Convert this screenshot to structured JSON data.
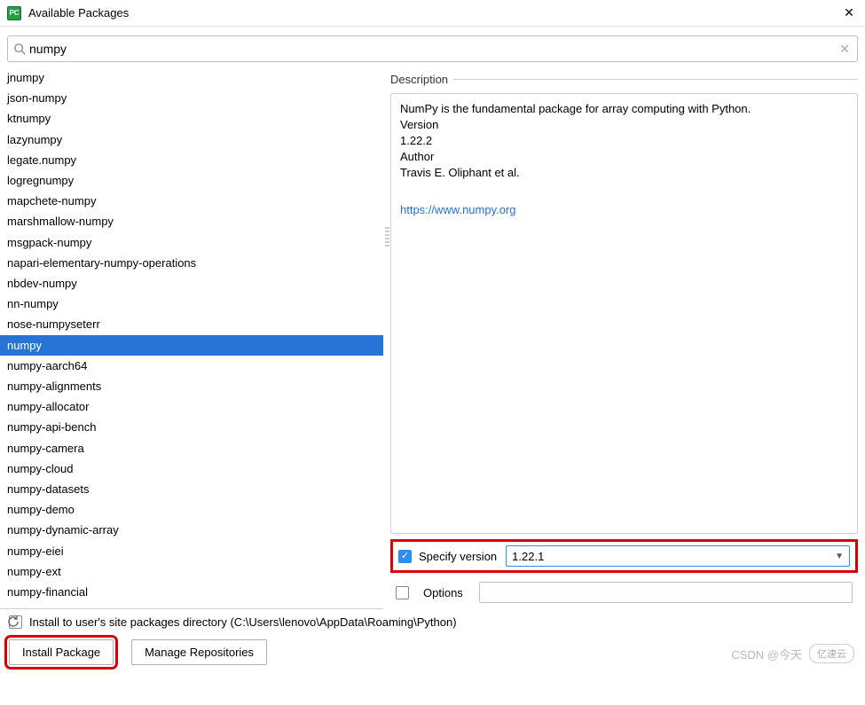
{
  "window": {
    "title": "Available Packages"
  },
  "search": {
    "value": "numpy"
  },
  "packages": {
    "selected_index": 13,
    "items": [
      "jnumpy",
      "json-numpy",
      "ktnumpy",
      "lazynumpy",
      "legate.numpy",
      "logregnumpy",
      "mapchete-numpy",
      "marshmallow-numpy",
      "msgpack-numpy",
      "napari-elementary-numpy-operations",
      "nbdev-numpy",
      "nn-numpy",
      "nose-numpyseterr",
      "numpy",
      "numpy-aarch64",
      "numpy-alignments",
      "numpy-allocator",
      "numpy-api-bench",
      "numpy-camera",
      "numpy-cloud",
      "numpy-datasets",
      "numpy-demo",
      "numpy-dynamic-array",
      "numpy-eiei",
      "numpy-ext",
      "numpy-financial"
    ]
  },
  "description": {
    "header": "Description",
    "summary": "NumPy is the fundamental package for array computing with Python.",
    "version_label": "Version",
    "version_value": "1.22.2",
    "author_label": "Author",
    "author_value": "Travis E. Oliphant et al.",
    "link_text": "https://www.numpy.org"
  },
  "specify_version": {
    "label": "Specify version",
    "checked": true,
    "value": "1.22.1"
  },
  "options": {
    "label": "Options",
    "checked": false,
    "value": ""
  },
  "install_to_user": {
    "checked": false,
    "label": "Install to user's site packages directory (C:\\Users\\lenovo\\AppData\\Roaming\\Python)"
  },
  "buttons": {
    "install": "Install Package",
    "manage": "Manage Repositories"
  },
  "watermark": {
    "text": "CSDN @今天",
    "logo": "亿速云"
  }
}
